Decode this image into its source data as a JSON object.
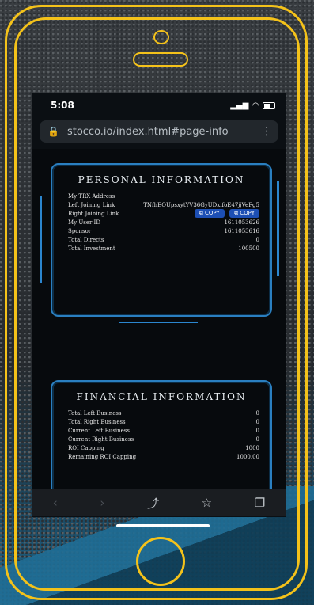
{
  "status_bar": {
    "time": "5:08"
  },
  "browser": {
    "url": "stocco.io/index.html#page-info"
  },
  "personal": {
    "title": "PERSONAL INFORMATION",
    "rows": [
      {
        "label": "My TRX Address",
        "value": ""
      },
      {
        "label": "Left Joining Link",
        "value": "TNfhEQUpsxytYV36GyUDxifoE47jjVeFg5"
      },
      {
        "label": "Right Joining Link",
        "value": ""
      },
      {
        "label": "My User ID",
        "value": "1611053626"
      },
      {
        "label": "Sponsor",
        "value": "1611053616"
      },
      {
        "label": "Total Directs",
        "value": "0"
      },
      {
        "label": "Total Investment",
        "value": "100500"
      }
    ],
    "copy_left": "COPY",
    "copy_right": "COPY"
  },
  "financial": {
    "title": "FINANCIAL INFORMATION",
    "rows": [
      {
        "label": "Total Left Business",
        "value": "0"
      },
      {
        "label": "Total Right Business",
        "value": "0"
      },
      {
        "label": "Current Left Business",
        "value": "0"
      },
      {
        "label": "Current Right Business",
        "value": "0"
      },
      {
        "label": "ROI Capping",
        "value": "1000"
      },
      {
        "label": "Remaining ROI Capping",
        "value": "1000.00"
      }
    ]
  },
  "toolbar_icons": [
    "back-icon",
    "forward-icon",
    "share-icon",
    "bookmark-icon",
    "tabs-icon"
  ],
  "colors": {
    "frame": "#f4c21a",
    "panel": "#2a7fc0",
    "copy_button": "#1d4fb4"
  }
}
